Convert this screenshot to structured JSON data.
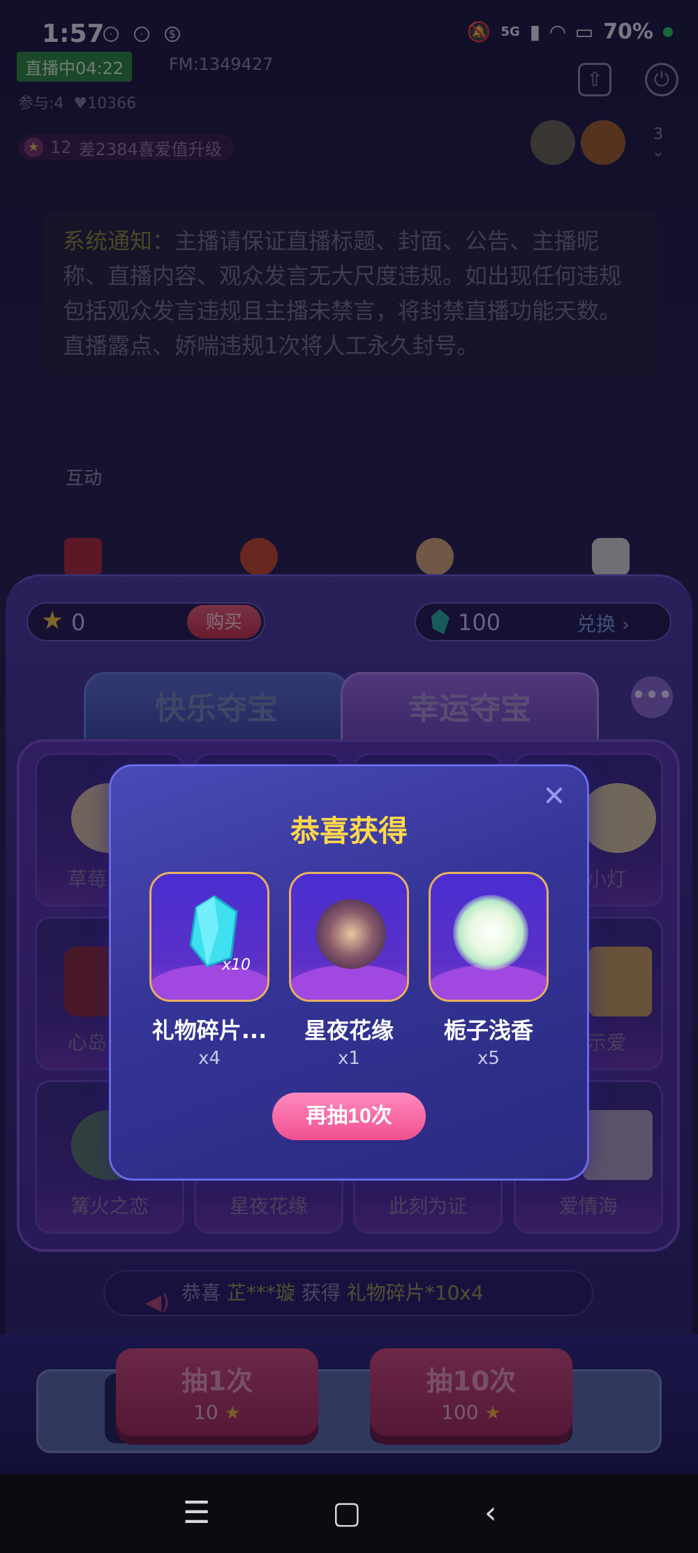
{
  "status_bar": {
    "time": "1:57",
    "network": "5G",
    "battery": "70%"
  },
  "room": {
    "live_badge": "直播中04:22",
    "fm_id": "FM:1349427",
    "participants": "参与:4",
    "likes": "10366",
    "level": "12",
    "upgrade_text": "差2384喜爱值升级",
    "viewer_count": "3",
    "notice_tag": "系统通知",
    "notice_body": "：主播请保证直播标题、封面、公告、主播昵称、直播内容、观众发言无大尺度违规。如出现任何违规包括观众发言违规且主播未禁言，将封禁直播功能天数。直播露点、娇喘违规1次将人工永久封号。",
    "interact_label": "互动"
  },
  "lottery": {
    "stars_balance": "0",
    "buy_label": "购买",
    "shards_balance": "100",
    "exchange_label": "兑换",
    "tabs": [
      {
        "label": "快乐夺宝"
      },
      {
        "label": "幸运夺宝"
      }
    ],
    "more_label": "•••",
    "grid_items": [
      {
        "label": "草莓"
      },
      {
        "label": ""
      },
      {
        "label": ""
      },
      {
        "label": "小灯"
      },
      {
        "label": "心岛"
      },
      {
        "label": ""
      },
      {
        "label": ""
      },
      {
        "label": "示爱"
      },
      {
        "label": "篝火之恋"
      },
      {
        "label": "星夜花缘"
      },
      {
        "label": "此刻为证"
      },
      {
        "label": "爱情海"
      }
    ],
    "broadcast": {
      "prefix": "恭喜",
      "user": "芷***璇",
      "verb": "获得",
      "item": "礼物碎片*10x4"
    },
    "draw_once": {
      "label": "抽1次",
      "cost": "10"
    },
    "draw_ten": {
      "label": "抽10次",
      "cost": "100"
    }
  },
  "modal": {
    "title": "恭喜获得",
    "prizes": [
      {
        "name": "礼物碎片...",
        "qty": "x4",
        "badge": "x10"
      },
      {
        "name": "星夜花缘",
        "qty": "x1"
      },
      {
        "name": "栀子浅香",
        "qty": "x5"
      }
    ],
    "redraw_label": "再抽10次"
  },
  "colors": {
    "modal_bg": "#343496",
    "title_gold": "#ffd84a",
    "redraw_pink": "#f0508e",
    "card_border": "#e8b060"
  },
  "icons": [
    "share-icon",
    "power-icon",
    "star-icon",
    "shard-icon",
    "chevron-right-icon",
    "close-icon",
    "speaker-icon",
    "menu-icon",
    "home-icon",
    "back-icon"
  ]
}
